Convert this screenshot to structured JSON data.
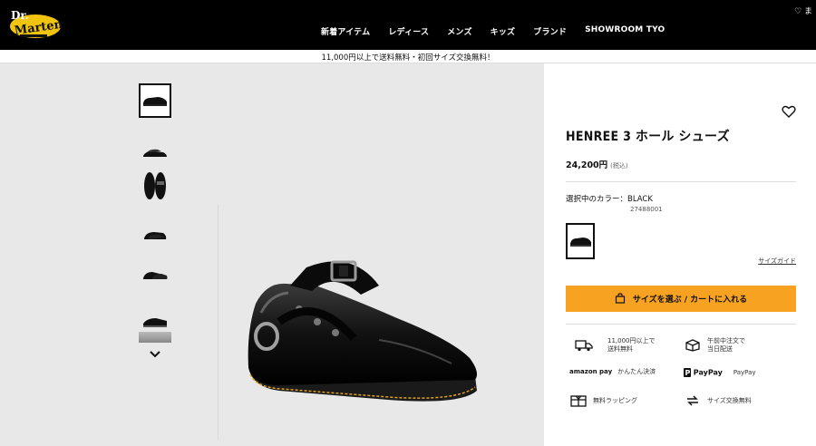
{
  "header": {
    "brand": "Dr. Martens",
    "nav": [
      {
        "label": "新着アイテム"
      },
      {
        "label": "レディース"
      },
      {
        "label": "メンズ"
      },
      {
        "label": "キッズ"
      },
      {
        "label": "ブランド"
      },
      {
        "label": "SHOWROOM TYO"
      }
    ],
    "top_right_text": "♡ ま"
  },
  "promo": {
    "text": "11,000円以上で送料無料・初回サイズ交換無料！"
  },
  "gallery": {
    "thumbnails": [
      {
        "view": "side",
        "active": true
      },
      {
        "view": "pair-side",
        "active": false
      },
      {
        "view": "top",
        "active": false
      },
      {
        "view": "three-quarter",
        "active": false
      },
      {
        "view": "pair-front",
        "active": false
      },
      {
        "view": "sole-detail",
        "active": false
      },
      {
        "view": "partial",
        "active": false
      }
    ],
    "scroll_icon": "chevron-down-icon"
  },
  "product": {
    "name": "HENREE 3 ホール シューズ",
    "price": "24,200円",
    "tax_note": "(税込)",
    "color_label": "選択中のカラー：BLACK",
    "sku": "27488001",
    "size_guide": "サイズガイド",
    "cart_button": "サイズを選ぶ / カートに入れる",
    "accent_color": "#f7a220"
  },
  "features": [
    {
      "icon": "truck-icon",
      "line1": "11,000円以上で",
      "line2": "送料無料"
    },
    {
      "icon": "box-icon",
      "line1": "午前中注文で",
      "line2": "当日配送"
    },
    {
      "icon": "amazon-pay-logo",
      "logo": "amazon pay",
      "line1": "かんたん決済",
      "line2": ""
    },
    {
      "icon": "paypal-logo",
      "logo": "PayPay",
      "line1": "PayPay",
      "line2": ""
    },
    {
      "icon": "gift-icon",
      "line1": "無料ラッピング",
      "line2": ""
    },
    {
      "icon": "exchange-icon",
      "line1": "サイズ交換無料",
      "line2": ""
    }
  ]
}
